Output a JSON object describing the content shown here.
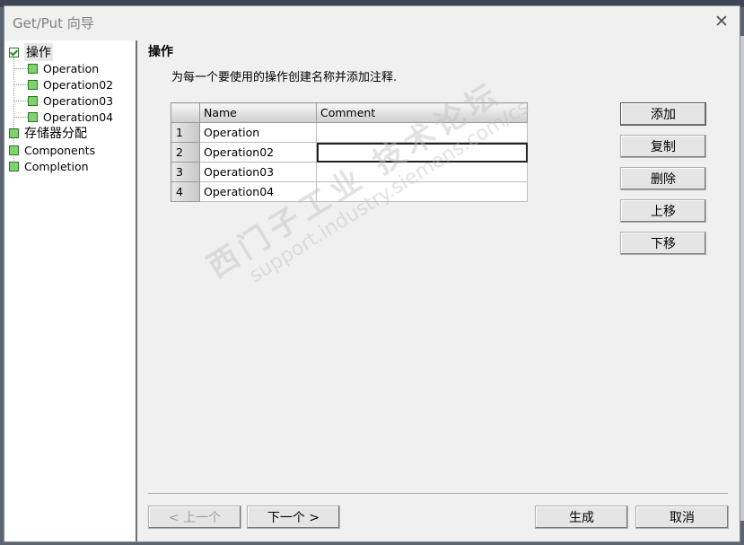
{
  "dialog": {
    "title": "Get/Put 向导",
    "close_glyph": "✕"
  },
  "tree": {
    "items": [
      {
        "label": "操作",
        "checked": true
      },
      {
        "label": "Operation"
      },
      {
        "label": "Operation02"
      },
      {
        "label": "Operation03"
      },
      {
        "label": "Operation04"
      },
      {
        "label": "存储器分配"
      },
      {
        "label": "Components"
      },
      {
        "label": "Completion"
      }
    ]
  },
  "main": {
    "title": "操作",
    "instruction": "为每一个要使用的操作创建名称并添加注释."
  },
  "grid": {
    "columns": [
      "Name",
      "Comment"
    ],
    "rows": [
      {
        "num": "1",
        "name": "Operation",
        "comment": ""
      },
      {
        "num": "2",
        "name": "Operation02",
        "comment": ""
      },
      {
        "num": "3",
        "name": "Operation03",
        "comment": ""
      },
      {
        "num": "4",
        "name": "Operation04",
        "comment": ""
      }
    ]
  },
  "side_buttons": {
    "add": "添加",
    "copy": "复制",
    "delete": "删除",
    "move_up": "上移",
    "move_down": "下移"
  },
  "footer_buttons": {
    "prev": "< 上一个",
    "next": "下一个 >",
    "generate": "生成",
    "cancel": "取消"
  },
  "watermark": {
    "line1": "西门子工业 技术论坛",
    "line2": "support.industry.siemens.com/cs"
  }
}
